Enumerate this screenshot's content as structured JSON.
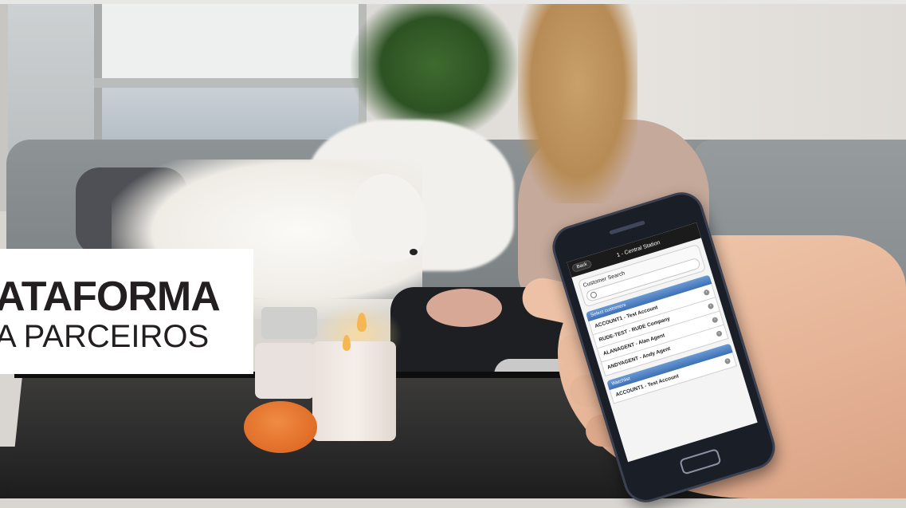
{
  "logo": {
    "line1": "ATAFORMA",
    "line2": "A PARCEIROS"
  },
  "phone_app": {
    "back_label": "Back",
    "title": "1 - Central Station",
    "search_label": "Customer Search",
    "search_placeholder": "",
    "groups": [
      {
        "header": "Select customers",
        "items": [
          "ACCOUNT1 - Test Account",
          "RUDE-TEST - RUDE Company",
          "ALANAGENT - Alan Agent",
          "ANDYAGENT - Andy Agent"
        ]
      },
      {
        "header": "Watchlist",
        "items": [
          "ACCOUNT1 - Test Account"
        ]
      }
    ]
  },
  "colors": {
    "logo_text": "#231f20",
    "app_bar": "#1b1b1b",
    "group_header": "#3d6fb5",
    "pumpkin": "#e0701f"
  }
}
